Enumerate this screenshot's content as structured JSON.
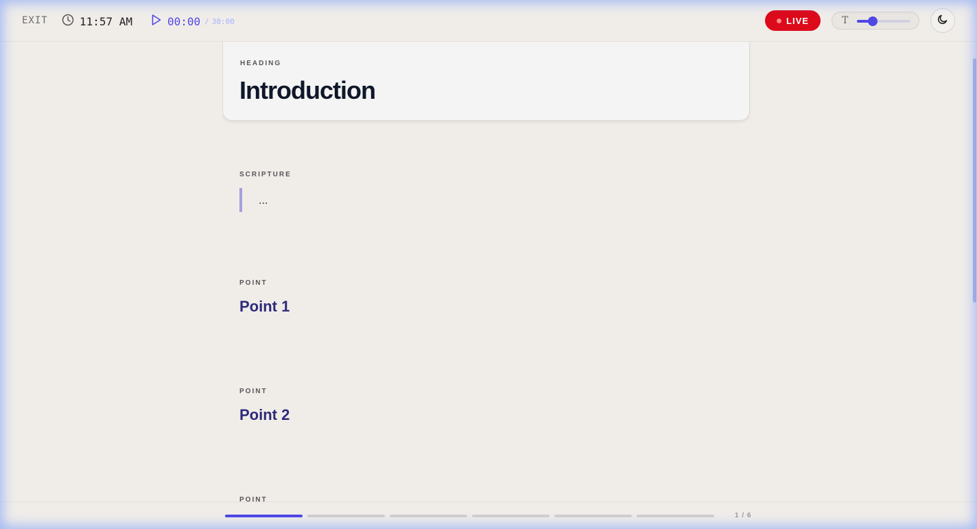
{
  "topbar": {
    "exit_label": "EXIT",
    "clock_time": "11:57 AM",
    "timer_elapsed": "00:00",
    "timer_separator": "/",
    "timer_total": "30:00",
    "live_label": "LIVE",
    "font_size_icon": "T",
    "font_size_level": 0.3,
    "theme_icon": "moon-icon"
  },
  "sections": [
    {
      "label": "HEADING",
      "title": "Introduction"
    },
    {
      "label": "SCRIPTURE",
      "text": "..."
    },
    {
      "label": "POINT",
      "title": "Point 1"
    },
    {
      "label": "POINT",
      "title": "Point 2"
    },
    {
      "label": "POINT",
      "title": ""
    }
  ],
  "footer": {
    "page_indicator": "1 / 6",
    "segments_total": 6,
    "segments_active": 1
  },
  "colors": {
    "accent": "#4f46e5",
    "live": "#dc0a1a",
    "point_title": "#2e2a7a",
    "background": "#f0ede9"
  }
}
